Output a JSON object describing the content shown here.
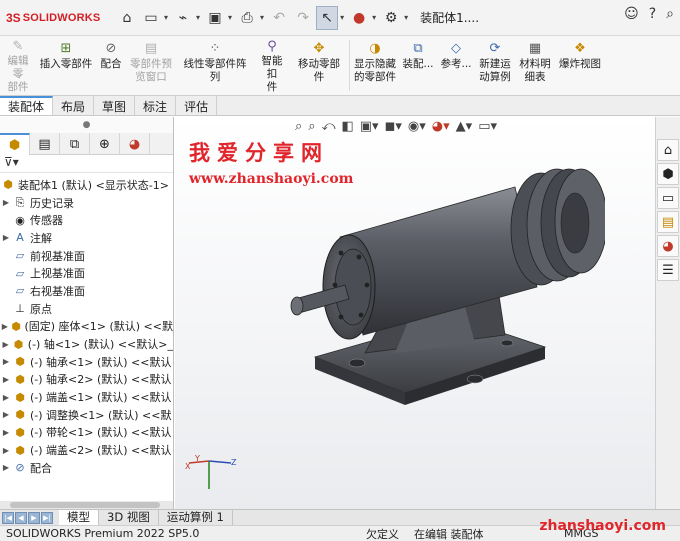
{
  "titlebar": {
    "brand_prefix": "3S",
    "brand_name": "SOLIDWORKS",
    "doc_title": "装配体1....",
    "icons": [
      "home-icon",
      "new-doc-icon",
      "open-icon",
      "save-icon",
      "print-icon",
      "undo-icon",
      "redo-icon",
      "select-pointer-icon",
      "traffic-light-icon",
      "options-gear-icon",
      "user-icon",
      "help-icon",
      "search-icon"
    ]
  },
  "ribbon": {
    "items": [
      {
        "label_1": "编辑零",
        "label_2": "部件",
        "icon": "edit-component-icon",
        "enabled": false
      },
      {
        "label_1": "插入零部件",
        "label_2": "",
        "icon": "insert-component-icon",
        "enabled": true
      },
      {
        "label_1": "配合",
        "label_2": "",
        "icon": "mate-paperclip-icon",
        "enabled": true
      },
      {
        "label_1": "零部件预",
        "label_2": "览窗口",
        "icon": "preview-window-icon",
        "enabled": false
      },
      {
        "label_1": "线性零部件阵列",
        "label_2": "",
        "icon": "linear-pattern-icon",
        "enabled": true
      },
      {
        "label_1": "智能扣",
        "label_2": "件",
        "icon": "smart-fastener-icon",
        "enabled": true
      },
      {
        "label_1": "移动零部件",
        "label_2": "",
        "icon": "move-component-icon",
        "enabled": true
      },
      {
        "label_1": "显示隐藏",
        "label_2": "的零部件",
        "icon": "show-hidden-icon",
        "enabled": true
      },
      {
        "label_1": "装配...",
        "label_2": "",
        "icon": "assembly-feature-icon",
        "enabled": true
      },
      {
        "label_1": "参考...",
        "label_2": "",
        "icon": "reference-geometry-icon",
        "enabled": true
      },
      {
        "label_1": "新建运",
        "label_2": "动算例",
        "icon": "new-motion-study-icon",
        "enabled": true
      },
      {
        "label_1": "材料明",
        "label_2": "细表",
        "icon": "bom-table-icon",
        "enabled": true
      },
      {
        "label_1": "爆炸视图",
        "label_2": "",
        "icon": "exploded-view-icon",
        "enabled": true
      }
    ]
  },
  "command_tabs": [
    "装配体",
    "布局",
    "草图",
    "标注",
    "评估"
  ],
  "feature_tree": {
    "panel_tabs": [
      "feature-manager-icon",
      "property-manager-icon",
      "configuration-manager-icon",
      "dimxpert-icon",
      "display-manager-icon"
    ],
    "filter_icon": "filter-icon",
    "root": "装配体1 (默认) <显示状态-1>",
    "items": [
      {
        "label": "历史记录",
        "icon": "history-icon",
        "expandable": true
      },
      {
        "label": "传感器",
        "icon": "sensor-icon",
        "expandable": false
      },
      {
        "label": "注解",
        "icon": "annotation-icon",
        "expandable": true
      },
      {
        "label": "前视基准面",
        "icon": "plane-icon",
        "expandable": false
      },
      {
        "label": "上视基准面",
        "icon": "plane-icon",
        "expandable": false
      },
      {
        "label": "右视基准面",
        "icon": "plane-icon",
        "expandable": false
      },
      {
        "label": "原点",
        "icon": "origin-icon",
        "expandable": false
      },
      {
        "label": "(固定) 座体<1> (默认) <<默",
        "icon": "part-icon",
        "expandable": true
      },
      {
        "label": "(-) 轴<1> (默认) <<默认>_",
        "icon": "part-icon",
        "expandable": true
      },
      {
        "label": "(-) 轴承<1> (默认) <<默认",
        "icon": "part-icon",
        "expandable": true
      },
      {
        "label": "(-) 轴承<2> (默认) <<默认",
        "icon": "part-icon",
        "expandable": true
      },
      {
        "label": "(-) 端盖<1> (默认) <<默认",
        "icon": "part-icon",
        "expandable": true
      },
      {
        "label": "(-) 调整换<1> (默认) <<默",
        "icon": "part-icon",
        "expandable": true
      },
      {
        "label": "(-) 带轮<1> (默认) <<默认",
        "icon": "part-icon",
        "expandable": true
      },
      {
        "label": "(-) 端盖<2> (默认) <<默认",
        "icon": "part-icon",
        "expandable": true
      },
      {
        "label": "配合",
        "icon": "mates-icon",
        "expandable": true
      }
    ]
  },
  "viewport": {
    "watermark_title": "我爱分享网",
    "watermark_url": "www.zhanshaoyi.com",
    "hud_icons": [
      "zoom-fit-icon",
      "zoom-area-icon",
      "previous-view-icon",
      "section-view-icon",
      "view-orientation-icon",
      "display-style-icon",
      "hide-show-icon",
      "appearance-icon",
      "scene-icon",
      "monitor-icon"
    ],
    "triad_labels": [
      "Y",
      "X",
      "Z"
    ]
  },
  "task_pane": [
    "home-resources-icon",
    "design-library-icon",
    "file-explorer-icon",
    "view-palette-icon",
    "appearances-icon",
    "custom-properties-icon"
  ],
  "bottom_tabs": [
    "模型",
    "3D 视图",
    "运动算例 1"
  ],
  "status_bar": {
    "product": "SOLIDWORKS Premium 2022 SP5.0",
    "state": "欠定义",
    "editing": "在编辑 装配体",
    "units": "MMGS",
    "watermark_url": "zhanshaoyi.com"
  },
  "colors": {
    "accent": "#4a90d9",
    "brand_red": "#d21f26",
    "watermark_red": "#e0262c",
    "model_body": "#5a5d64"
  }
}
